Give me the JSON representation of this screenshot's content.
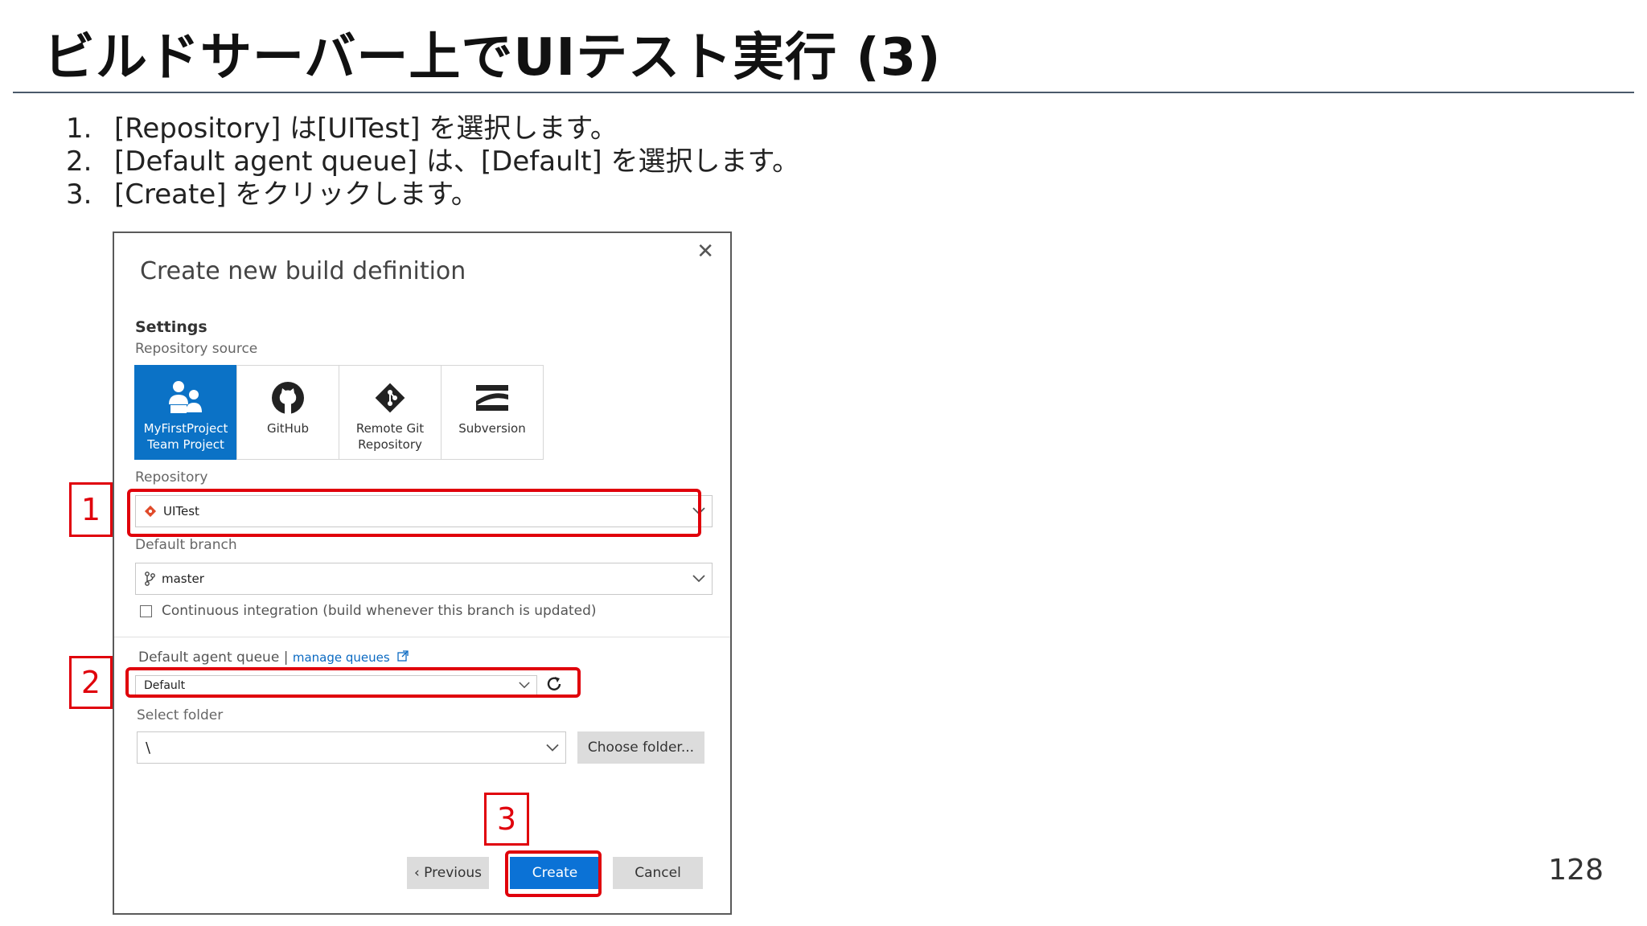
{
  "slide": {
    "title": "ビルドサーバー上でUIテスト実行 (3)",
    "page_number": "128",
    "steps": [
      {
        "num": "1.",
        "text": "[Repository] は[UITest] を選択します。"
      },
      {
        "num": "2.",
        "text": "[Default agent queue] は、[Default] を選択します。"
      },
      {
        "num": "3.",
        "text": "[Create] をクリックします。"
      }
    ]
  },
  "dialog": {
    "title": "Create new build definition",
    "close_glyph": "✕",
    "settings_heading": "Settings",
    "repository_source_label": "Repository source",
    "sources": [
      {
        "line1": "MyFirstProject",
        "line2": "Team Project",
        "icon": "team-project-icon"
      },
      {
        "line1": "GitHub",
        "line2": "",
        "icon": "github-icon"
      },
      {
        "line1": "Remote Git",
        "line2": "Repository",
        "icon": "git-icon"
      },
      {
        "line1": "Subversion",
        "line2": "",
        "icon": "subversion-icon"
      }
    ],
    "repository_label": "Repository",
    "repository_value": "UITest",
    "branch_label": "Default branch",
    "branch_value": "master",
    "ci_label": "Continuous integration (build whenever this branch is updated)",
    "queue_label": "Default agent queue |",
    "manage_queues": "manage queues",
    "queue_value": "Default",
    "folder_label": "Select folder",
    "folder_value": "\\",
    "choose_folder": "Choose folder...",
    "previous": "‹ Previous",
    "create": "Create",
    "cancel": "Cancel"
  },
  "annotations": {
    "one": "1",
    "two": "2",
    "three": "3",
    "color": "#e0000b"
  },
  "colors": {
    "accent": "#0b72c6",
    "create_button": "#0b72d6"
  }
}
